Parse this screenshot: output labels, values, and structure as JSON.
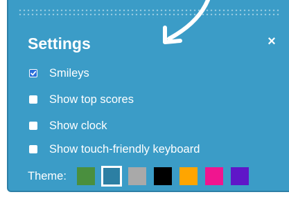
{
  "dialog": {
    "title": "Settings",
    "close_label": "×"
  },
  "options": [
    {
      "label": "Smileys",
      "checked": true
    },
    {
      "label": "Show top scores",
      "checked": false
    },
    {
      "label": "Show clock",
      "checked": false
    },
    {
      "label": "Show touch-friendly keyboard",
      "checked": false
    }
  ],
  "theme": {
    "label": "Theme:",
    "swatches": [
      {
        "name": "green",
        "color": "#4a8f3e",
        "selected": false
      },
      {
        "name": "blue",
        "color": "#2c7fa3",
        "selected": true
      },
      {
        "name": "gray",
        "color": "#a9a9a9",
        "selected": false
      },
      {
        "name": "black",
        "color": "#000000",
        "selected": false
      },
      {
        "name": "orange",
        "color": "#ffa500",
        "selected": false
      },
      {
        "name": "pink",
        "color": "#f0158f",
        "selected": false
      },
      {
        "name": "purple",
        "color": "#5f16c8",
        "selected": false
      }
    ]
  },
  "colors": {
    "panel_background": "#3b9cc7",
    "text": "#ffffff",
    "checkbox_checked": "#2a6fdb"
  },
  "icons": {
    "drag_handle": "dotted-drag-handle-icon",
    "close": "close-icon",
    "checkmark": "checkmark-icon",
    "annotation": "arrow-pointer-icon"
  }
}
